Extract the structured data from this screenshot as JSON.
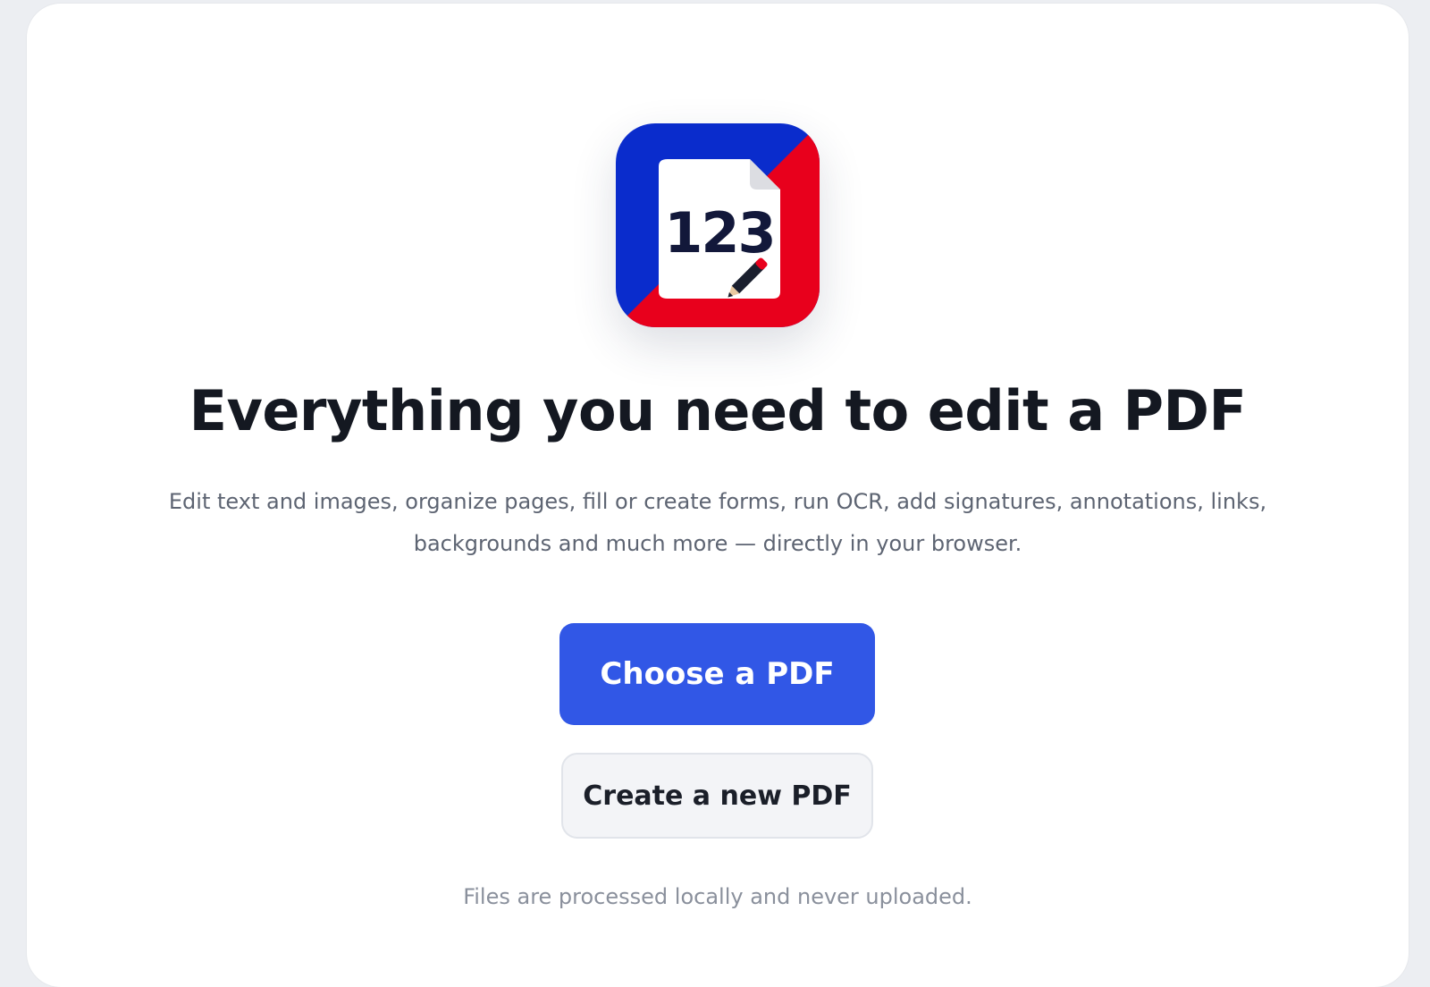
{
  "hero": {
    "logo_text": "123",
    "headline": "Everything you need to edit a PDF",
    "subtitle": "Edit text and images, organize pages, fill or create forms, run OCR, add signatures, annotations, links, backgrounds and much more — directly in your browser.",
    "primary_button_label": "Choose a PDF",
    "secondary_button_label": "Create a new PDF",
    "footnote": "Files are processed locally and never uploaded."
  },
  "colors": {
    "brand_blue": "#0a2ccc",
    "brand_red": "#e8001c",
    "primary_button": "#3157e6",
    "headline": "#141821",
    "subtitle": "#5d6472"
  },
  "icons": {
    "logo": "document-123-pencil-icon"
  }
}
